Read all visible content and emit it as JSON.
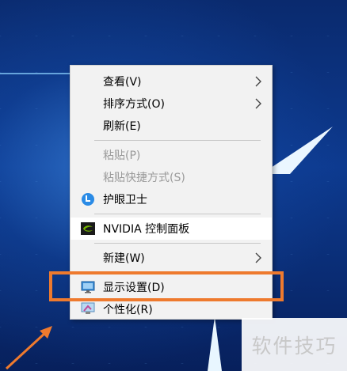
{
  "menu": {
    "items": [
      {
        "label": "查看(V)",
        "enabled": true,
        "submenu": true
      },
      {
        "label": "排序方式(O)",
        "enabled": true,
        "submenu": true
      },
      {
        "label": "刷新(E)",
        "enabled": true,
        "submenu": false
      },
      {
        "label": "粘贴(P)",
        "enabled": false,
        "submenu": false
      },
      {
        "label": "粘贴快捷方式(S)",
        "enabled": false,
        "submenu": false
      },
      {
        "label": "护眼卫士",
        "enabled": true,
        "submenu": false,
        "icon": "eye-guard-icon"
      },
      {
        "label": "NVIDIA 控制面板",
        "enabled": true,
        "submenu": false,
        "icon": "nvidia-icon"
      },
      {
        "label": "新建(W)",
        "enabled": true,
        "submenu": true
      },
      {
        "label": "显示设置(D)",
        "enabled": true,
        "submenu": false,
        "icon": "display-settings-icon"
      },
      {
        "label": "个性化(R)",
        "enabled": true,
        "submenu": false,
        "icon": "personalize-icon"
      }
    ]
  },
  "highlight": {
    "color": "#ee7a2e"
  },
  "watermark": {
    "text": "软件技巧"
  }
}
